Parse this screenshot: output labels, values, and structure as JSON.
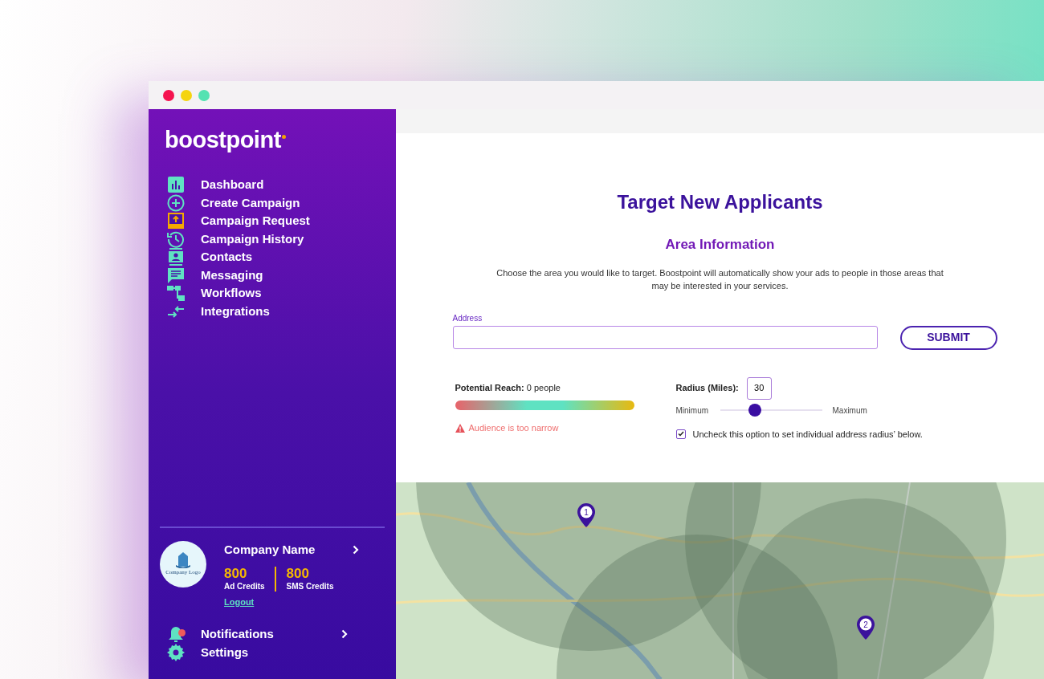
{
  "brand": {
    "name": "boostpoint"
  },
  "nav": [
    {
      "label": "Dashboard"
    },
    {
      "label": "Create Campaign"
    },
    {
      "label": "Campaign Request"
    },
    {
      "label": "Campaign History"
    },
    {
      "label": "Contacts"
    },
    {
      "label": "Messaging"
    },
    {
      "label": "Workflows"
    },
    {
      "label": "Integrations"
    }
  ],
  "account": {
    "logo_text": "Company Logo",
    "company": "Company Name",
    "credits": [
      {
        "value": "800",
        "label": "Ad Credits"
      },
      {
        "value": "800",
        "label": "SMS Credits"
      }
    ],
    "logout": "Logout"
  },
  "footer_nav": [
    {
      "label": "Notifications",
      "unread": true
    },
    {
      "label": "Settings",
      "unread": false
    }
  ],
  "main": {
    "title": "Target New Applicants",
    "section": "Area Information",
    "description": "Choose the area you would like to target. Boostpoint will automatically show your ads to people in those areas that may be interested in your services.",
    "address": {
      "label": "Address"
    },
    "submit": "SUBMIT",
    "reach": {
      "label": "Potential Reach:",
      "value": "0 people",
      "warning": "Audience is too narrow"
    },
    "radius": {
      "label": "Radius (Miles):",
      "value": "30",
      "min_label": "Minimum",
      "max_label": "Maximum",
      "level": 0.34
    },
    "individual": {
      "label": "Uncheck this option to set individual address radius’ below.",
      "checked": true
    }
  },
  "map": {
    "pins": [
      {
        "label": "1"
      },
      {
        "label": "2"
      }
    ]
  }
}
